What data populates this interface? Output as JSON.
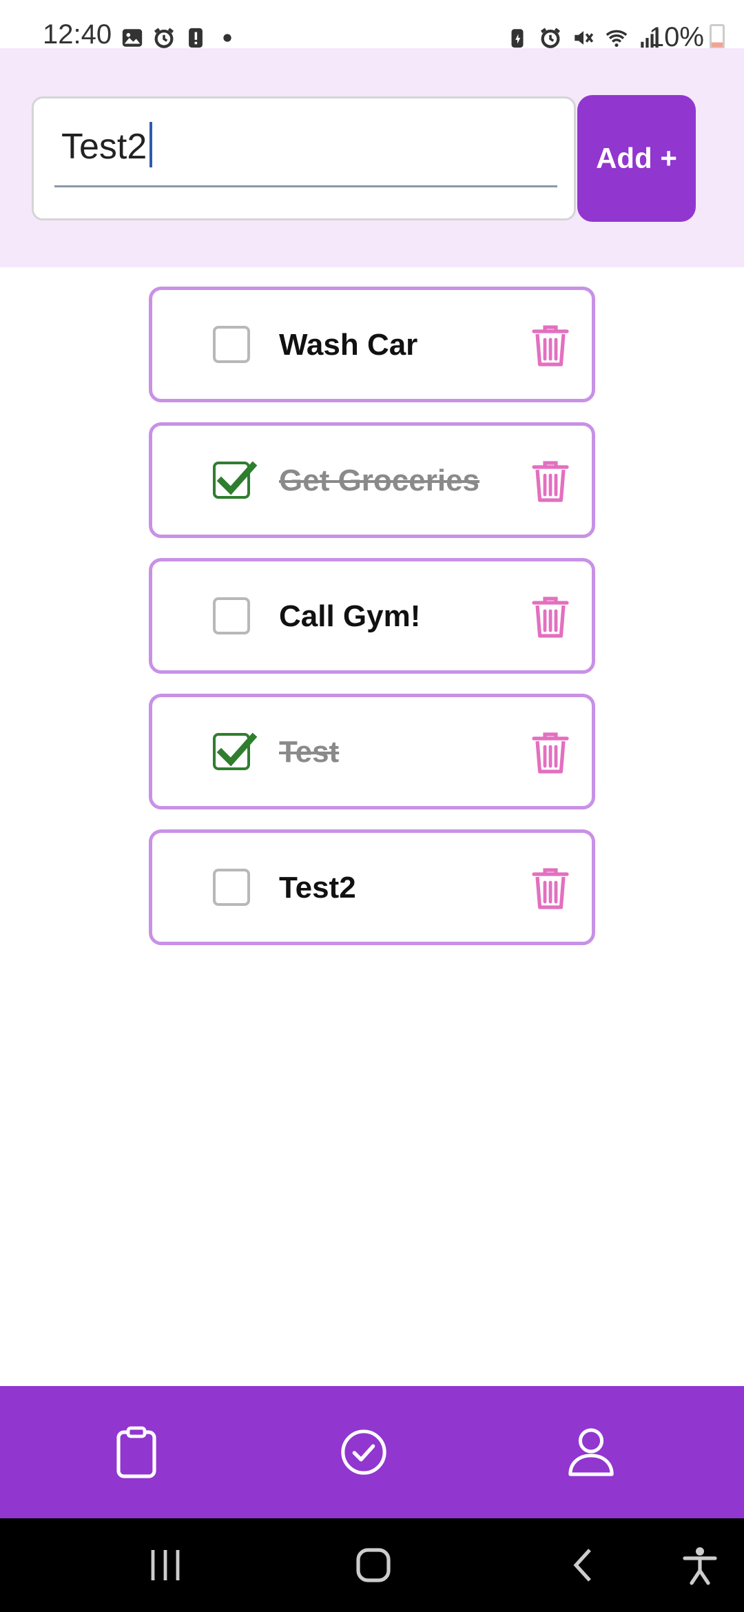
{
  "status_bar": {
    "time": "12:40",
    "battery_text": "10%",
    "left_icons": [
      "image-icon",
      "alarm-icon",
      "alert-icon",
      "dot-icon"
    ],
    "right_icons": [
      "battery-saver-icon",
      "alarm-icon",
      "mute-icon",
      "wifi-icon",
      "signal-icon"
    ]
  },
  "input": {
    "value": "Test2",
    "add_label": "Add +"
  },
  "tasks": [
    {
      "label": "Wash Car",
      "done": false
    },
    {
      "label": "Get Groceries",
      "done": true
    },
    {
      "label": "Call Gym!",
      "done": false
    },
    {
      "label": "Test",
      "done": true
    },
    {
      "label": "Test2",
      "done": false
    }
  ],
  "colors": {
    "accent": "#9136cf",
    "header_bg": "#f5e8fb",
    "card_border": "#c891e6",
    "trash": "#e36fbf",
    "check": "#2f7d2f"
  },
  "bottom_nav": [
    "clipboard-icon",
    "check-circle-icon",
    "user-icon"
  ]
}
